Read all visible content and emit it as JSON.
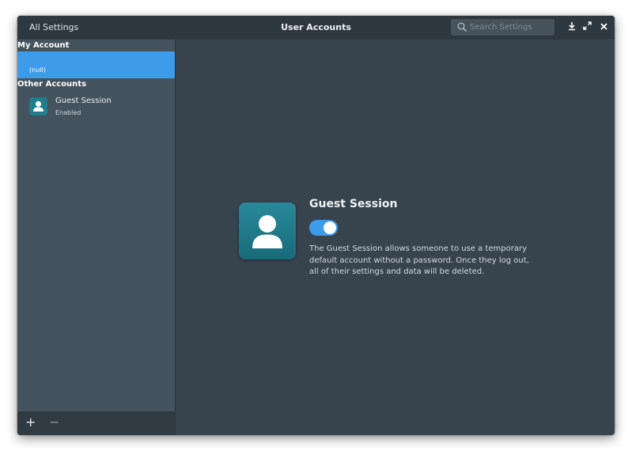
{
  "titlebar": {
    "back_label": "All Settings",
    "title": "User Accounts",
    "search_placeholder": "Search Settings"
  },
  "sidebar": {
    "my_account_header": "My Account",
    "my_account_name": "(null)",
    "other_accounts_header": "Other Accounts",
    "guest": {
      "name": "Guest Session",
      "status": "Enabled"
    },
    "add_label": "+",
    "remove_label": "−"
  },
  "main": {
    "title": "Guest Session",
    "toggle_on": true,
    "description": "The Guest Session allows someone to use a temporary default account without a password. Once they log out, all of their settings and data will be deleted."
  },
  "colors": {
    "accent": "#3d9be9",
    "avatar": "#1f7d8e",
    "background": "#37434d"
  },
  "icons": [
    "search-icon",
    "download-icon",
    "maximize-icon",
    "close-icon",
    "user-icon"
  ]
}
